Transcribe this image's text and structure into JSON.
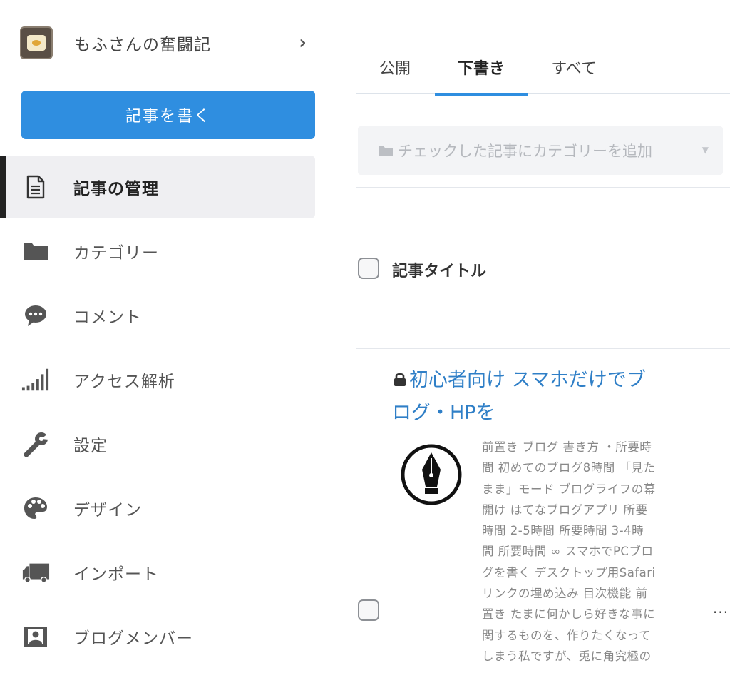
{
  "sidebar": {
    "blog_name": "もふさんの奮闘記",
    "write_button": "記事を書く",
    "items": [
      {
        "label": "記事の管理",
        "icon": "document-icon",
        "active": true
      },
      {
        "label": "カテゴリー",
        "icon": "folder-icon"
      },
      {
        "label": "コメント",
        "icon": "comment-icon"
      },
      {
        "label": "アクセス解析",
        "icon": "signal-bars-icon"
      },
      {
        "label": "設定",
        "icon": "wrench-icon"
      },
      {
        "label": "デザイン",
        "icon": "palette-icon"
      },
      {
        "label": "インポート",
        "icon": "truck-icon"
      },
      {
        "label": "ブログメンバー",
        "icon": "member-card-icon"
      }
    ]
  },
  "tabs": [
    {
      "label": "公開"
    },
    {
      "label": "下書き",
      "active": true
    },
    {
      "label": "すべて"
    }
  ],
  "category_select": {
    "label": "チェックした記事にカテゴリーを追加"
  },
  "list": {
    "column_header": "記事タイトル",
    "articles": [
      {
        "title": "初心者向け スマホだけでブログ・HPを",
        "title_lines": [
          "初心者向け スマホだけでブ",
          "ログ・HPを"
        ],
        "private": true,
        "thumbnail_icon": "pen-nib-icon",
        "excerpt_lines": [
          "前置き ブログ 書き方 ・所要時",
          "間 初めてのブログ8時間 「見た",
          "まま」モード ブログライフの幕",
          "開け はてなブログアプリ 所要",
          "時間 2-5時間 所要時間 3-4時",
          "間 所要時間 ∞ スマホでPCブロ",
          "グを書く デスクトップ用Safari",
          "リンクの埋め込み 目次機能 前",
          "置き たまに何かしら好きな事に",
          "関するものを、作りたくなって",
          "しまう私ですが、兎に角究極の"
        ],
        "more_label": "..."
      }
    ]
  },
  "colors": {
    "accent": "#2f8ee0",
    "link": "#2f7fc7",
    "active_nav_bg": "#efeff2",
    "active_bar": "#222222"
  }
}
